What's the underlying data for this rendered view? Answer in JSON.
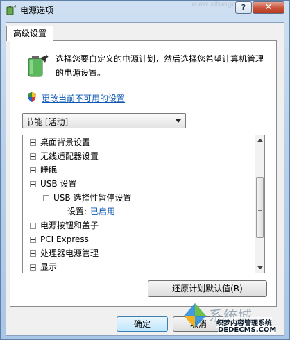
{
  "window": {
    "title": "电源选项",
    "help_label": "?",
    "close_label": "✕"
  },
  "tab": {
    "label": "高级设置"
  },
  "description": "选择您要自定义的电源计划，然后选择您希望计算机管理的电源设置。",
  "change_link": "更改当前不可用的设置",
  "plan_select": {
    "value": "节能 [活动]"
  },
  "tree": [
    {
      "label": "桌面背景设置",
      "expander": "plus"
    },
    {
      "label": "无线适配器设置",
      "expander": "plus"
    },
    {
      "label": "睡眠",
      "expander": "plus"
    },
    {
      "label": "USB 设置",
      "expander": "minus"
    },
    {
      "label": "USB 选择性暂停设置",
      "expander": "minus"
    },
    {
      "label": "设置:",
      "value": "已启用"
    },
    {
      "label": "电源按钮和盖子",
      "expander": "plus"
    },
    {
      "label": "PCI Express",
      "expander": "plus"
    },
    {
      "label": "处理器电源管理",
      "expander": "plus"
    },
    {
      "label": "显示",
      "expander": "plus"
    }
  ],
  "buttons": {
    "restore": "还原计划默认值(R)",
    "ok": "确定",
    "cancel": "取消"
  },
  "watermark": {
    "big": "系统城",
    "small": "织梦内容管理系统",
    "url": "DEDECMS.COM",
    "top_url": "www.xitongcheng.com"
  }
}
